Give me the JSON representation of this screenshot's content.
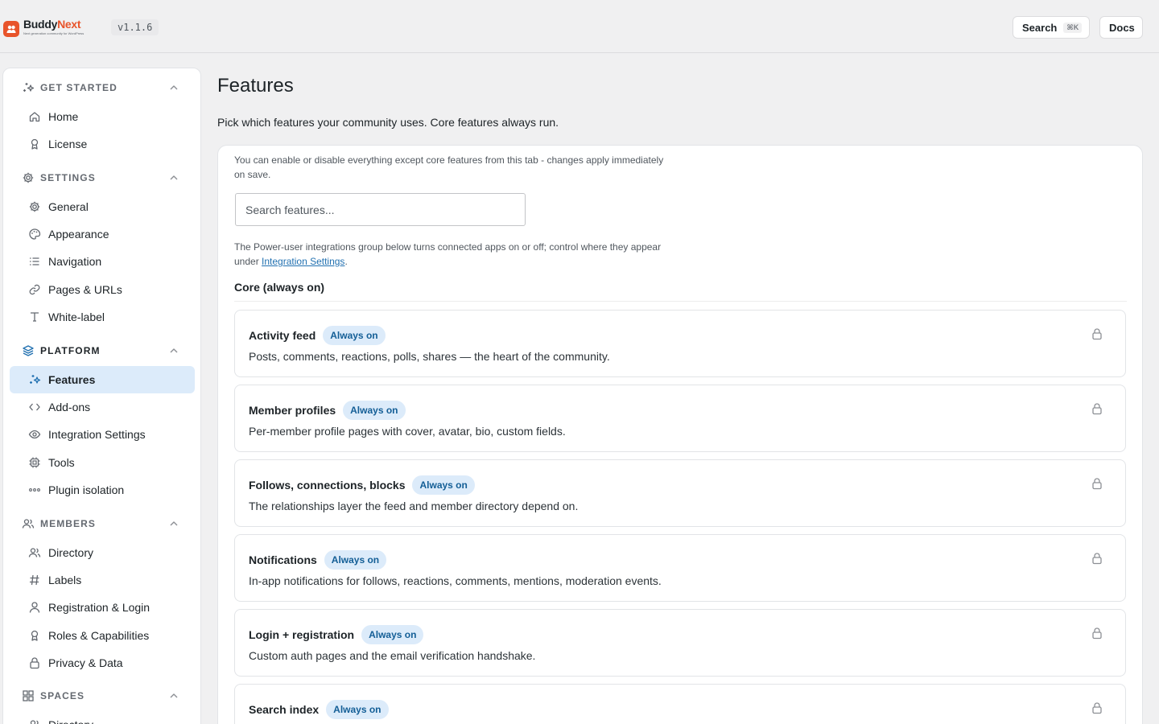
{
  "header": {
    "brand_part1": "Buddy",
    "brand_part2": "Next",
    "brand_tagline": "Next generation community for WordPress",
    "version": "v1.1.6",
    "search_label": "Search",
    "search_shortcut": "⌘K",
    "docs_label": "Docs"
  },
  "sidebar": {
    "sections": [
      {
        "title": "GET STARTED",
        "icon": "sparkles-icon",
        "items": [
          {
            "label": "Home",
            "icon": "home-icon"
          },
          {
            "label": "License",
            "icon": "award-icon"
          }
        ]
      },
      {
        "title": "SETTINGS",
        "icon": "gear-icon",
        "items": [
          {
            "label": "General",
            "icon": "gear-icon"
          },
          {
            "label": "Appearance",
            "icon": "palette-icon"
          },
          {
            "label": "Navigation",
            "icon": "list-icon"
          },
          {
            "label": "Pages & URLs",
            "icon": "link-icon"
          },
          {
            "label": "White-label",
            "icon": "type-icon"
          }
        ]
      },
      {
        "title": "PLATFORM",
        "icon": "layers-icon",
        "items": [
          {
            "label": "Features",
            "icon": "sparkles-icon",
            "active": true
          },
          {
            "label": "Add-ons",
            "icon": "code-icon"
          },
          {
            "label": "Integration Settings",
            "icon": "eye-icon"
          },
          {
            "label": "Tools",
            "icon": "cpu-icon"
          },
          {
            "label": "Plugin isolation",
            "icon": "dots-icon"
          }
        ]
      },
      {
        "title": "MEMBERS",
        "icon": "users-icon",
        "items": [
          {
            "label": "Directory",
            "icon": "users-icon"
          },
          {
            "label": "Labels",
            "icon": "hash-icon"
          },
          {
            "label": "Registration & Login",
            "icon": "user-icon"
          },
          {
            "label": "Roles & Capabilities",
            "icon": "award-icon"
          },
          {
            "label": "Privacy & Data",
            "icon": "lock-icon"
          }
        ]
      },
      {
        "title": "SPACES",
        "icon": "grid-icon",
        "items": [
          {
            "label": "Directory",
            "icon": "users-icon"
          }
        ]
      }
    ]
  },
  "main": {
    "title": "Features",
    "subtitle": "Pick which features your community uses. Core features always run.",
    "note_top": "You can enable or disable everything except core features from this tab - changes apply immediately on save.",
    "search_placeholder": "Search features...",
    "note_bottom_prefix": "The Power-user integrations group below turns connected apps on or off; control where they appear under ",
    "note_bottom_link": "Integration Settings",
    "note_bottom_suffix": ".",
    "group_title": "Core (always on)",
    "features": [
      {
        "name": "Activity feed",
        "badge": "Always on",
        "desc": "Posts, comments, reactions, polls, shares — the heart of the community."
      },
      {
        "name": "Member profiles",
        "badge": "Always on",
        "desc": "Per-member profile pages with cover, avatar, bio, custom fields."
      },
      {
        "name": "Follows, connections, blocks",
        "badge": "Always on",
        "desc": "The relationships layer the feed and member directory depend on."
      },
      {
        "name": "Notifications",
        "badge": "Always on",
        "desc": "In-app notifications for follows, reactions, comments, mentions, moderation events."
      },
      {
        "name": "Login + registration",
        "badge": "Always on",
        "desc": "Custom auth pages and the email verification handshake."
      },
      {
        "name": "Search index",
        "badge": "Always on",
        "desc": ""
      }
    ]
  },
  "colors": {
    "accent": "#2271b1",
    "brand": "#e8542b",
    "active_bg": "#dcebfa",
    "page_bg": "#f0f0f1"
  }
}
